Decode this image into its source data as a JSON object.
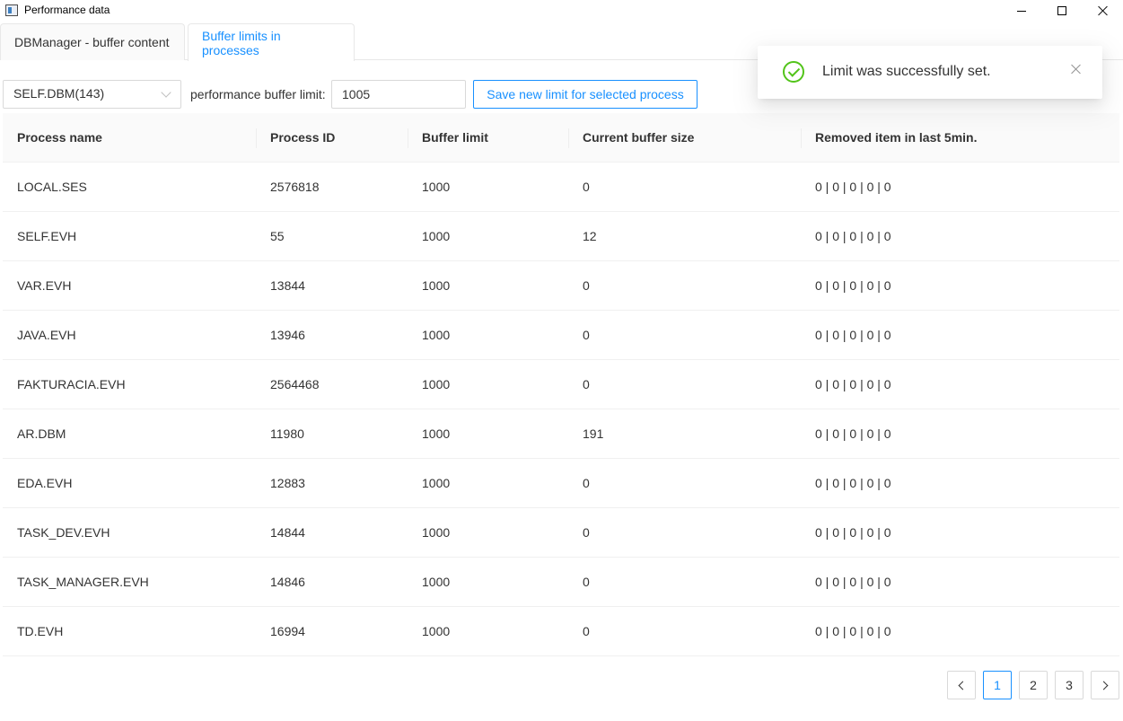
{
  "window": {
    "title": "Performance data"
  },
  "tabs": [
    {
      "label": "DBManager - buffer content",
      "active": false
    },
    {
      "label": "Buffer limits in processes",
      "active": true
    }
  ],
  "controls": {
    "process_select_value": "SELF.DBM(143)",
    "limit_label": "performance buffer limit:",
    "limit_input_value": "1005",
    "save_button_label": "Save new limit for selected process"
  },
  "notification": {
    "message": "Limit was successfully set.",
    "status_color": "#52c41a"
  },
  "table": {
    "columns": [
      "Process name",
      "Process ID",
      "Buffer limit",
      "Current buffer size",
      "Removed item in last 5min."
    ],
    "rows": [
      [
        "LOCAL.SES",
        "2576818",
        "1000",
        "0",
        "0 | 0 | 0 | 0 | 0"
      ],
      [
        "SELF.EVH",
        "55",
        "1000",
        "12",
        "0 | 0 | 0 | 0 | 0"
      ],
      [
        "VAR.EVH",
        "13844",
        "1000",
        "0",
        "0 | 0 | 0 | 0 | 0"
      ],
      [
        "JAVA.EVH",
        "13946",
        "1000",
        "0",
        "0 | 0 | 0 | 0 | 0"
      ],
      [
        "FAKTURACIA.EVH",
        "2564468",
        "1000",
        "0",
        "0 | 0 | 0 | 0 | 0"
      ],
      [
        "AR.DBM",
        "11980",
        "1000",
        "191",
        "0 | 0 | 0 | 0 | 0"
      ],
      [
        "EDA.EVH",
        "12883",
        "1000",
        "0",
        "0 | 0 | 0 | 0 | 0"
      ],
      [
        "TASK_DEV.EVH",
        "14844",
        "1000",
        "0",
        "0 | 0 | 0 | 0 | 0"
      ],
      [
        "TASK_MANAGER.EVH",
        "14846",
        "1000",
        "0",
        "0 | 0 | 0 | 0 | 0"
      ],
      [
        "TD.EVH",
        "16994",
        "1000",
        "0",
        "0 | 0 | 0 | 0 | 0"
      ]
    ]
  },
  "pagination": {
    "pages": [
      "1",
      "2",
      "3"
    ],
    "current": "1"
  },
  "colors": {
    "accent": "#1890ff",
    "success": "#52c41a"
  }
}
